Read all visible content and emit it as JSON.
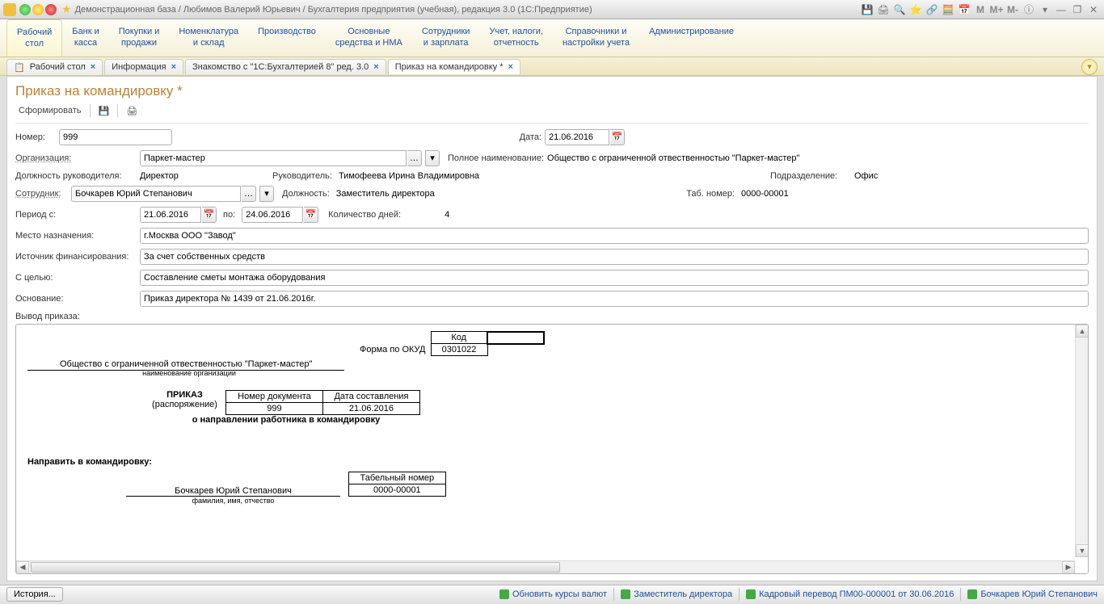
{
  "titlebar": {
    "title": "Демонстрационная база / Любимов Валерий Юрьевич / Бухгалтерия предприятия (учебная), редакция 3.0  (1С:Предприятие)"
  },
  "mainmenu": [
    "Рабочий\nстол",
    "Банк и\nкасса",
    "Покупки и\nпродажи",
    "Номенклатура\nи склад",
    "Производство",
    "Основные\nсредства и НМА",
    "Сотрудники\nи зарплата",
    "Учет, налоги,\nотчетность",
    "Справочники и\nнастройки учета",
    "Администрирование"
  ],
  "tabs": [
    {
      "label": "Рабочий стол"
    },
    {
      "label": "Информация"
    },
    {
      "label": "Знакомство с \"1С:Бухгалтерией 8\" ред. 3.0"
    },
    {
      "label": "Приказ на командировку *",
      "active": true
    }
  ],
  "page_title": "Приказ на командировку *",
  "toolbar": {
    "generate": "Сформировать"
  },
  "form": {
    "number_label": "Номер:",
    "number": "999",
    "date_label": "Дата:",
    "date": "21.06.2016",
    "org_label": "Организация:",
    "org": "Паркет-мастер",
    "full_name_label": "Полное наименование:",
    "full_name": "Общество с ограниченной отвественностью \"Паркет-мастер\"",
    "head_pos_label": "Должность руководителя:",
    "head_pos": "Директор",
    "head_label": "Руководитель:",
    "head": "Тимофеева Ирина Владимировна",
    "dept_label": "Подразделение:",
    "dept": "Офис",
    "emp_label": "Сотрудник:",
    "emp": "Бочкарев Юрий Степанович",
    "emp_pos_label": "Должность:",
    "emp_pos": "Заместитель директора",
    "tab_no_label": "Таб. номер:",
    "tab_no": "0000-00001",
    "period_label": "Период с:",
    "period_from": "21.06.2016",
    "period_to_label": "по:",
    "period_to": "24.06.2016",
    "days_label": "Количество дней:",
    "days": "4",
    "dest_label": "Место назначения:",
    "dest": "г.Москва ООО \"Завод\"",
    "funding_label": "Источник финансирования:",
    "funding": "За счет собственных средств",
    "purpose_label": "С целью:",
    "purpose": "Составление сметы монтажа оборудования",
    "basis_label": "Основание:",
    "basis": "Приказ директора № 1439 от 21.06.2016г.",
    "output_label": "Вывод приказа:"
  },
  "preview": {
    "code_label": "Код",
    "okud_label": "Форма по ОКУД",
    "okud": "0301022",
    "org_full": "Общество с ограниченной отвественностью \"Паркет-мастер\"",
    "org_caption": "наименование организации",
    "doc_no_hdr": "Номер документа",
    "doc_date_hdr": "Дата составления",
    "doc_no": "999",
    "doc_date": "21.06.2016",
    "title": "ПРИКАЗ",
    "subtitle": "(распоряжение)",
    "about": "о направлении работника в командировку",
    "send_label": "Направить в командировку:",
    "emp_name": "Бочкарев Юрий Степанович",
    "emp_caption": "фамилия, имя, отчество",
    "tab_hdr": "Табельный номер",
    "tab_val": "0000-00001"
  },
  "statusbar": {
    "history": "История...",
    "rates": "Обновить курсы валют",
    "vice": "Заместитель директора",
    "transfer": "Кадровый перевод ПМ00-000001 от 30.06.2016",
    "emp": "Бочкарев Юрий Степанович"
  }
}
